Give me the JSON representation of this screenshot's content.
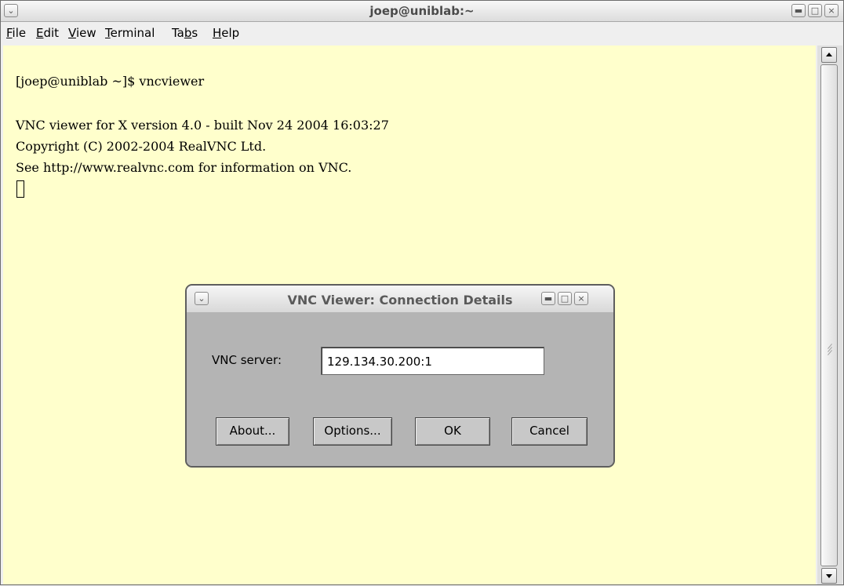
{
  "window": {
    "title": "joep@uniblab:~"
  },
  "menubar": {
    "items": [
      {
        "pre": "",
        "key": "F",
        "post": "ile"
      },
      {
        "pre": "",
        "key": "E",
        "post": "dit"
      },
      {
        "pre": "",
        "key": "V",
        "post": "iew"
      },
      {
        "pre": "",
        "key": "T",
        "post": "erminal"
      },
      {
        "pre": "Ta",
        "key": "b",
        "post": "s"
      },
      {
        "pre": "",
        "key": "H",
        "post": "elp"
      }
    ]
  },
  "terminal": {
    "lines": [
      "[joep@uniblab ~]$ vncviewer",
      "",
      "VNC viewer for X version 4.0 - built Nov 24 2004 16:03:27",
      "Copyright (C) 2002-2004 RealVNC Ltd.",
      "See http://www.realvnc.com for information on VNC."
    ],
    "background_color": "#ffffcc"
  },
  "dialog": {
    "title": "VNC Viewer: Connection Details",
    "server_label": "VNC server:",
    "server_value": "129.134.30.200:1",
    "buttons": {
      "about": "About...",
      "options": "Options...",
      "ok": "OK",
      "cancel": "Cancel"
    }
  }
}
